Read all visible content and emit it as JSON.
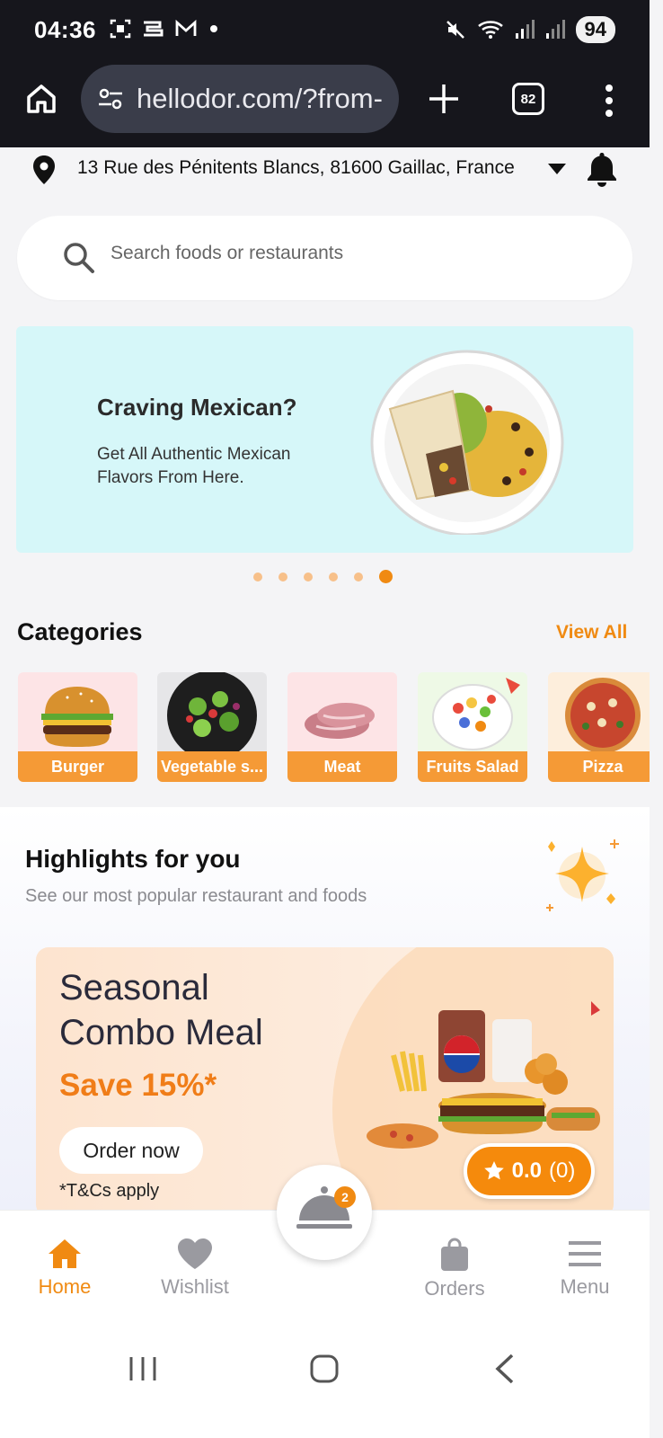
{
  "status_bar": {
    "time": "04:36",
    "battery": "94"
  },
  "browser": {
    "url": "hellodor.com/?from-",
    "tab_count": "82"
  },
  "location": {
    "address": "13 Rue des Pénitents Blancs, 81600 Gaillac, France"
  },
  "search": {
    "placeholder": "Search foods or restaurants"
  },
  "banner": {
    "title": "Craving Mexican?",
    "subtitle": "Get All Authentic Mexican Flavors From Here.",
    "background": "#d6f7f9",
    "slide_count": 6,
    "active_slide": 6
  },
  "categories": {
    "title": "Categories",
    "view_all": "View All",
    "items": [
      {
        "label": "Burger"
      },
      {
        "label": "Vegetable s..."
      },
      {
        "label": "Meat"
      },
      {
        "label": "Fruits Salad"
      },
      {
        "label": "Pizza"
      }
    ]
  },
  "highlights": {
    "title": "Highlights for you",
    "subtitle": "See our most popular restaurant and foods",
    "promo": {
      "title_line1": "Seasonal",
      "title_line2": "Combo Meal",
      "save": "Save 15%*",
      "button": "Order now",
      "terms": "*T&Cs apply",
      "rating": "0.0",
      "rating_count": "(0)"
    }
  },
  "bottom_nav": {
    "items": [
      {
        "label": "Home",
        "icon": "home-icon",
        "active": true
      },
      {
        "label": "Wishlist",
        "icon": "heart-icon",
        "active": false
      },
      {
        "label": "Orders",
        "icon": "bag-icon",
        "active": false
      },
      {
        "label": "Menu",
        "icon": "menu-icon",
        "active": false
      }
    ],
    "cart_badge": "2"
  },
  "colors": {
    "accent": "#f08a12",
    "dark_bar": "#16161c"
  }
}
